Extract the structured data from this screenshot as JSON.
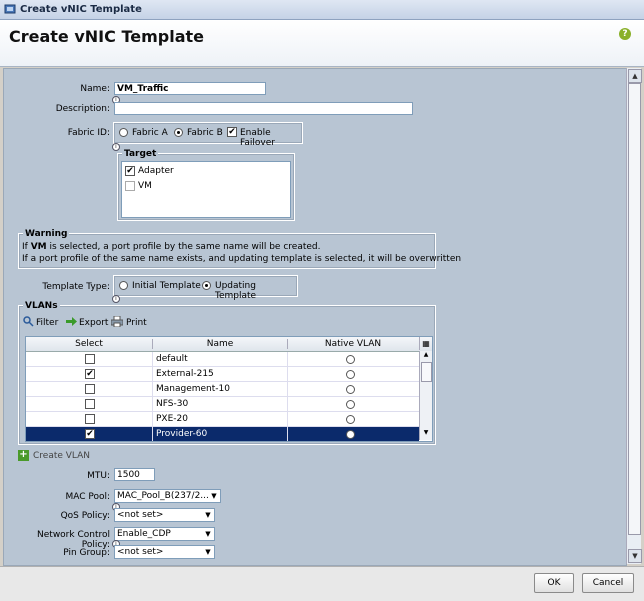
{
  "window": {
    "title": "Create vNIC Template",
    "header": "Create vNIC Template",
    "help_icon": "?"
  },
  "form": {
    "name_label": "Name:",
    "name_value": "VM_Traffic",
    "description_label": "Description:",
    "description_value": "",
    "fabric_label": "Fabric ID:",
    "fabric_a": "Fabric A",
    "fabric_b": "Fabric B",
    "enable_failover": "Enable Failover",
    "target_title": "Target",
    "target_adapter": "Adapter",
    "target_vm": "VM",
    "warning_title": "Warning",
    "warning_line1_pre": "If ",
    "warning_line1_bold": "VM",
    "warning_line1_post": " is selected, a port profile by the same name will be created.",
    "warning_line2": "If a port profile of the same name exists, and updating template is selected, it will be overwritten",
    "template_type_label": "Template Type:",
    "initial_template": "Initial Template",
    "updating_template": "Updating Template"
  },
  "vlans": {
    "title": "VLANs",
    "toolbar": {
      "filter": "Filter",
      "export": "Export",
      "print": "Print"
    },
    "columns": [
      "Select",
      "Name",
      "Native VLAN"
    ],
    "rows": [
      {
        "checked": false,
        "name": "default",
        "selected": false
      },
      {
        "checked": true,
        "name": "External-215",
        "selected": false
      },
      {
        "checked": false,
        "name": "Management-10",
        "selected": false
      },
      {
        "checked": false,
        "name": "NFS-30",
        "selected": false
      },
      {
        "checked": false,
        "name": "PXE-20",
        "selected": false
      },
      {
        "checked": true,
        "name": "Provider-60",
        "selected": true
      }
    ],
    "create_vlan": "Create VLAN"
  },
  "settings": {
    "mtu_label": "MTU:",
    "mtu_value": "1500",
    "mac_pool_label": "MAC Pool:",
    "mac_pool_value": "MAC_Pool_B(237/2...",
    "qos_label": "QoS Policy:",
    "qos_value": "<not set>",
    "ncp_label": "Network Control Policy:",
    "ncp_value": "Enable_CDP",
    "pin_label": "Pin Group:",
    "pin_value": "<not set>"
  },
  "footer": {
    "ok": "OK",
    "cancel": "Cancel"
  },
  "colors": {
    "panel_bg": "#b8c5d3",
    "selected_row": "#0b2a6b"
  }
}
